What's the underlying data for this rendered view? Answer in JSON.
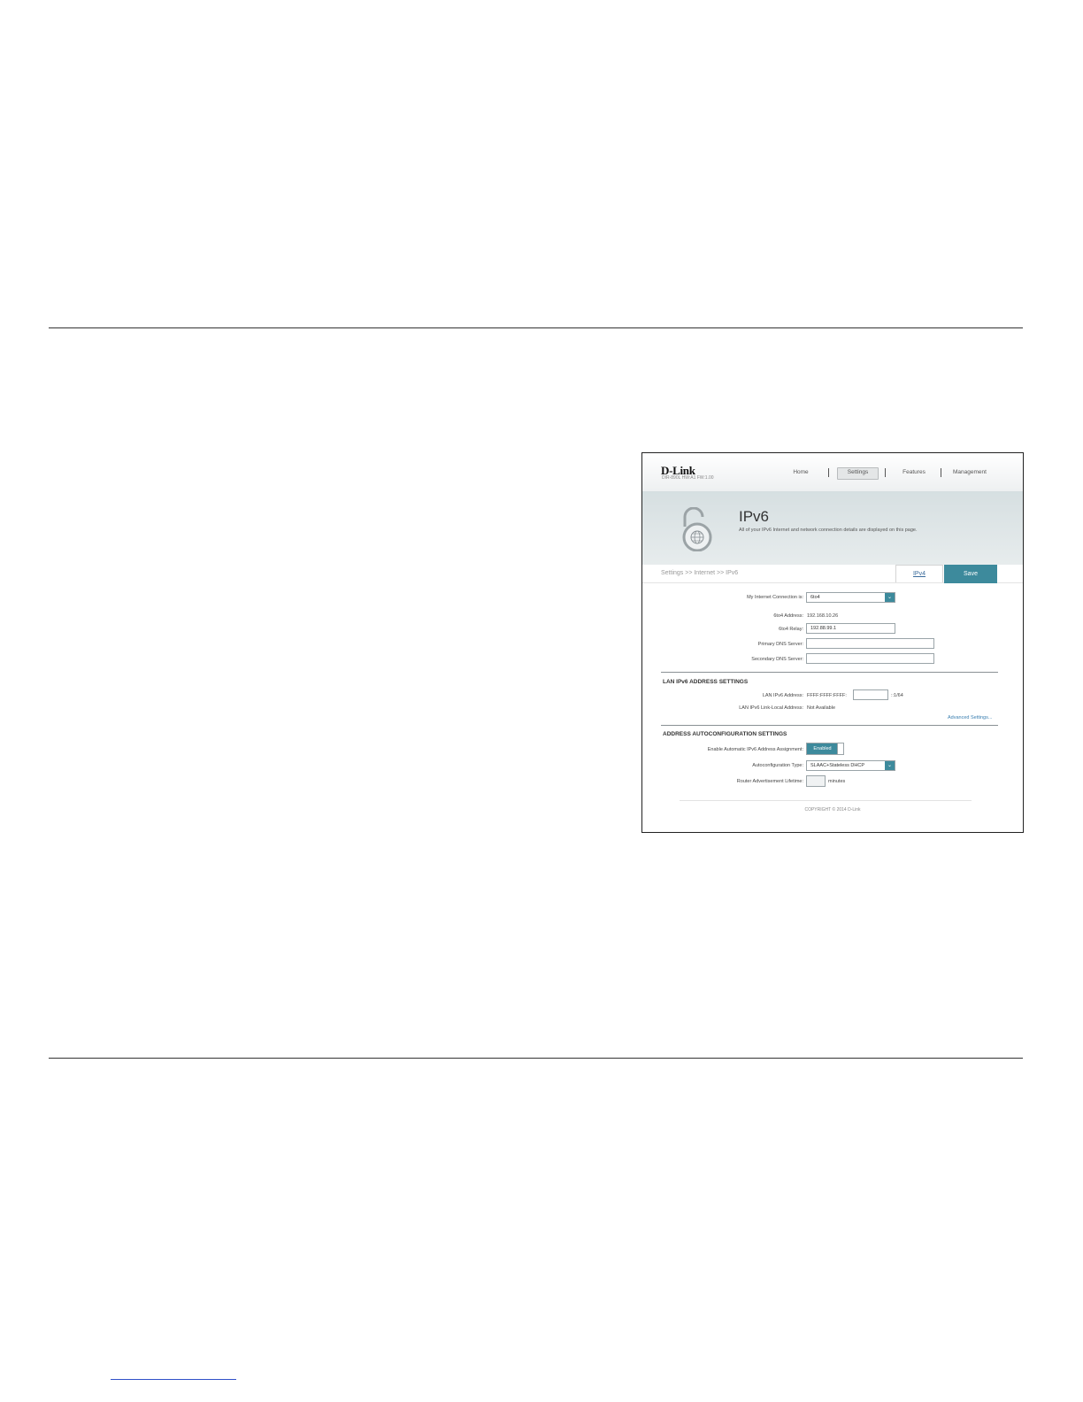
{
  "router": {
    "brand": "D-Link",
    "model_line": "DIR-890L   HW:A1   FW:1.00",
    "nav": [
      {
        "label": "Home"
      },
      {
        "label": "Settings"
      },
      {
        "label": "Features"
      },
      {
        "label": "Management"
      }
    ],
    "active_nav": "Settings",
    "page_title": "IPv6",
    "page_desc": "All of your IPv6 Internet and network connection details are displayed on this page.",
    "breadcrumb": "Settings >> Internet >> IPv6",
    "ipv4_tab": "IPv4",
    "save_label": "Save",
    "connection": {
      "label": "My Internet Connection is:",
      "value": "6to4"
    },
    "address": {
      "label": "6to4 Address:",
      "value": "192.168.10.26"
    },
    "relay": {
      "label": "6to4 Relay:",
      "value": "192.88.99.1"
    },
    "primary_dns": {
      "label": "Primary DNS Server:",
      "value": ""
    },
    "secondary_dns": {
      "label": "Secondary DNS Server:",
      "value": ""
    },
    "lan_section": {
      "title": "LAN IPv6 ADDRESS SETTINGS",
      "lan_address_label": "LAN IPv6 Address:",
      "lan_address_prefix": "FFFF:FFFF:FFFF:",
      "lan_address_input": "",
      "lan_address_suffix": "::1/64",
      "link_local_label": "LAN IPv6 Link-Local Address:",
      "link_local_value": "Not Available",
      "advanced_link": "Advanced Settings..."
    },
    "auto_section": {
      "title": "ADDRESS AUTOCONFIGURATION SETTINGS",
      "enable_label": "Enable Automatic IPv6 Address Assignment:",
      "enable_value": "Enabled",
      "type_label": "Autoconfiguration Type:",
      "type_value": "SLAAC+Stateless DHCP",
      "lifetime_label": "Router Advertisement Lifetime:",
      "lifetime_value": "",
      "lifetime_unit": "minutes"
    },
    "copyright": "COPYRIGHT © 2014 D-Link"
  },
  "colors": {
    "accent": "#3d8a9c",
    "banner": "#dce4e6"
  }
}
